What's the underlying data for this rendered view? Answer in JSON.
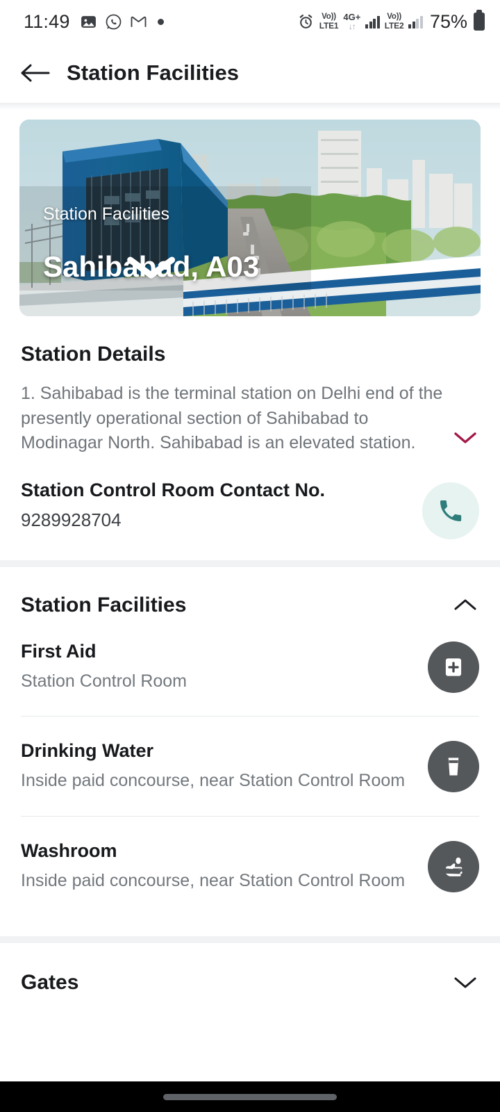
{
  "status_bar": {
    "time": "11:49",
    "left_icons": [
      "photos-icon",
      "whatsapp-icon",
      "gmail-icon",
      "dot-indicator"
    ],
    "alarm_icon": "alarm-icon",
    "sim1_volte_upper": "Vo))",
    "sim1_volte_lower": "LTE1",
    "network_type": "4G+",
    "data_arrows": "↓↑",
    "sim2_volte_upper": "Vo))",
    "sim2_volte_lower": "LTE2",
    "battery_percent": "75%"
  },
  "app_bar": {
    "back_label": "back-arrow",
    "title": "Station Facilities"
  },
  "hero": {
    "overlay_label": "Station Facilities",
    "station_name": "Sahibabad, A03",
    "dropdown_icon": "chevron-down-icon"
  },
  "station_details": {
    "title": "Station Details",
    "text": "1. Sahibabad is the terminal station on Delhi end of the presently operational section of Sahibabad to Modinagar North. Sahibabad is an elevated station.",
    "expand_icon": "chevron-down-icon",
    "expand_icon_color": "#a3194a"
  },
  "contact": {
    "label": "Station Control Room Contact No.",
    "number": "9289928704",
    "call_icon": "phone-icon",
    "call_icon_color": "#2e7d7b",
    "call_bg_color": "#e7f3f1"
  },
  "facilities_section": {
    "title": "Station Facilities",
    "collapse_icon": "chevron-up-icon",
    "items": [
      {
        "name": "First Aid",
        "description": "Station Control Room",
        "icon": "first-aid-kit-icon"
      },
      {
        "name": "Drinking Water",
        "description": "Inside paid concourse, near Station Control Room",
        "icon": "water-glass-icon"
      },
      {
        "name": "Washroom",
        "description": "Inside paid concourse, near Station Control Room",
        "icon": "hand-wash-icon"
      }
    ],
    "icon_bg_color": "#55585b"
  },
  "gates_section": {
    "title": "Gates",
    "expand_icon": "chevron-down-icon"
  },
  "nav_bar": {
    "home_indicator": "home-gesture-pill"
  }
}
